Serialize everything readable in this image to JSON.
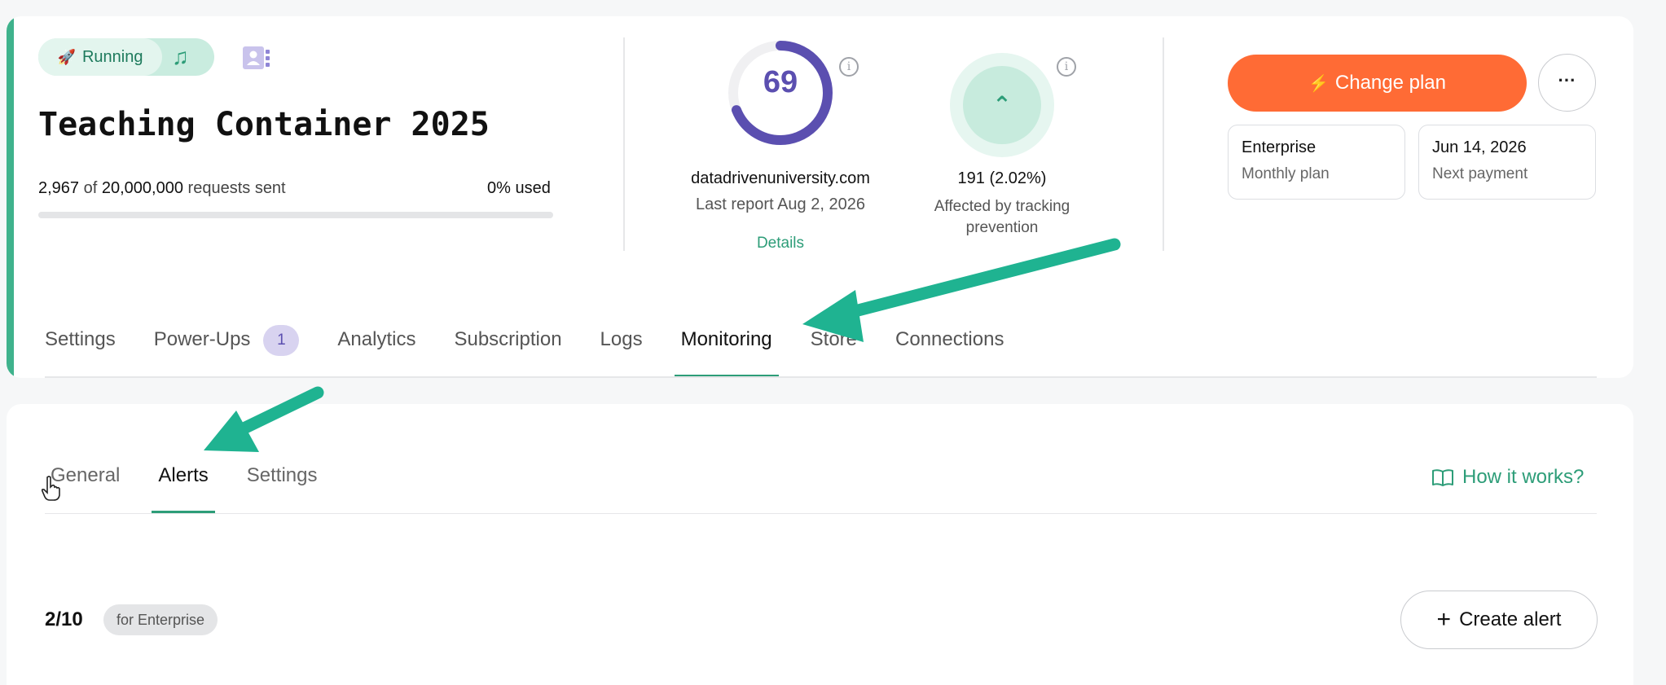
{
  "header": {
    "status": {
      "label": "Running",
      "icon": "rocket-icon",
      "secondary_icon": "music-icon"
    },
    "title": "Teaching Container 2025",
    "usage": {
      "sent": "2,967",
      "of": "of",
      "limit": "20,000,000",
      "suffix": "requests sent",
      "percent_label": "0% used",
      "fill_fraction": 0
    },
    "score": {
      "value": "69",
      "fraction": 0.69,
      "domain": "datadrivenuniversity.com",
      "last_report": "Last report Aug 2, 2026",
      "details_label": "Details"
    },
    "tracking": {
      "count": "191 (2.02%)",
      "label": "Affected by tracking prevention"
    },
    "plan": {
      "change_label": "Change plan",
      "more_label": "···",
      "tier": "Enterprise",
      "billing": "Monthly plan",
      "next_date": "Jun 14, 2026",
      "next_label": "Next payment"
    }
  },
  "main_tabs": [
    {
      "label": "Settings"
    },
    {
      "label": "Power-Ups",
      "badge": "1"
    },
    {
      "label": "Analytics"
    },
    {
      "label": "Subscription"
    },
    {
      "label": "Logs"
    },
    {
      "label": "Monitoring",
      "active": true
    },
    {
      "label": "Store"
    },
    {
      "label": "Connections"
    }
  ],
  "monitoring": {
    "sub_tabs": [
      {
        "label": "General"
      },
      {
        "label": "Alerts",
        "active": true
      },
      {
        "label": "Settings"
      }
    ],
    "how_it_works": "How it works?",
    "alert_count": "2/10",
    "plan_tag": "for Enterprise",
    "create_alert": "Create alert"
  },
  "colors": {
    "accent": "#2d9d78",
    "orange": "#ff6b35",
    "purple": "#5b4fb0"
  }
}
